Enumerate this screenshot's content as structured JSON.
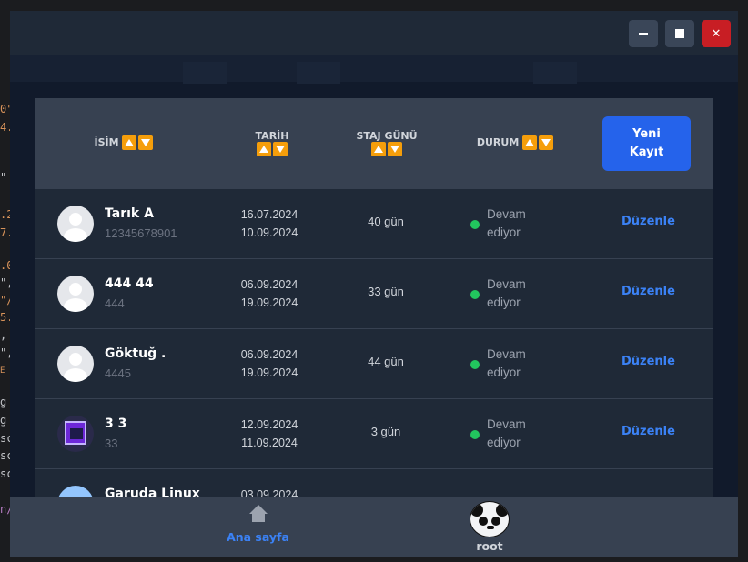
{
  "background_code": {
    "lines": [
      "0\"",
      "4.",
      "\"",
      ".2",
      "7.",
      ".0",
      "\",",
      "\"/",
      "5.",
      ",",
      "\",",
      "E",
      "g",
      "g",
      "sc",
      "sc",
      "sc",
      "n/"
    ]
  },
  "window": {
    "controls": {
      "minimize": "minimize-icon",
      "maximize": "maximize-icon",
      "close": "close-icon"
    }
  },
  "table": {
    "headers": {
      "name": "İSİM",
      "date": "TARİH",
      "days": "STAJ GÜNÜ",
      "status": "DURUM"
    },
    "new_button": "Yeni Kayıt",
    "rows": [
      {
        "name": "Tarık A",
        "sub": "12345678901",
        "start": "16.07.2024",
        "end": "10.09.2024",
        "days": "40 gün",
        "status": "Devam ediyor",
        "action": "Düzenle",
        "avatar": "default"
      },
      {
        "name": "444 44",
        "sub": "444",
        "start": "06.09.2024",
        "end": "19.09.2024",
        "days": "33 gün",
        "status": "Devam ediyor",
        "action": "Düzenle",
        "avatar": "default"
      },
      {
        "name": "Göktuğ .",
        "sub": "4445",
        "start": "06.09.2024",
        "end": "19.09.2024",
        "days": "44 gün",
        "status": "Devam ediyor",
        "action": "Düzenle",
        "avatar": "default"
      },
      {
        "name": "3 3",
        "sub": "33",
        "start": "12.09.2024",
        "end": "11.09.2024",
        "days": "3 gün",
        "status": "Devam ediyor",
        "action": "Düzenle",
        "avatar": "image"
      },
      {
        "name": "Garuda Linux",
        "sub": "",
        "start": "03.09.2024",
        "end": "",
        "days": "",
        "status": "",
        "action": "",
        "avatar": "image2"
      }
    ],
    "status_color": "#22c55e",
    "accent": "#3b82f6",
    "sort_color": "#f59e0b"
  },
  "bottom_nav": {
    "home_label": "Ana sayfa",
    "user_label": "root",
    "home_icon": "home-icon",
    "user_icon": "panda-avatar"
  }
}
